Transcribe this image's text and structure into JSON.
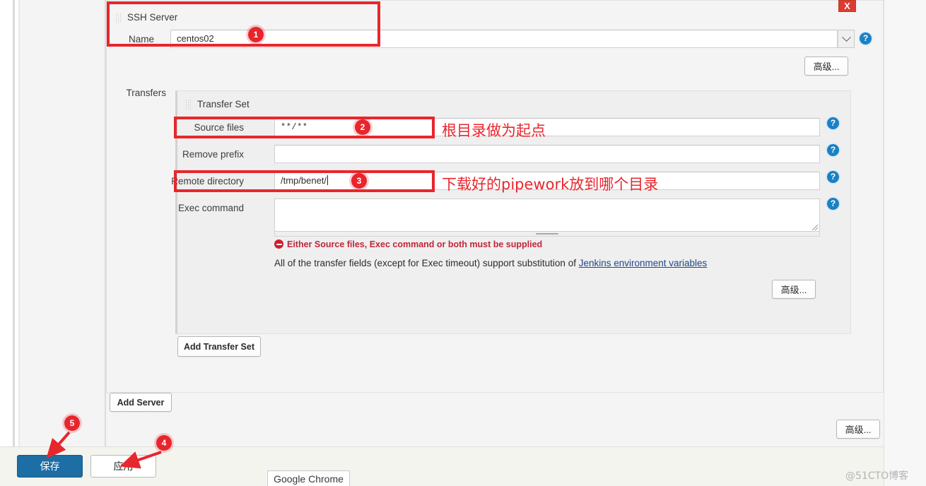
{
  "window": {
    "close_label": "X"
  },
  "server_section": {
    "title": "SSH Server",
    "name_label": "Name",
    "name_value": "centos02",
    "advanced_label": "高级...",
    "transfers_label": "Transfers",
    "add_server_label": "Add Server"
  },
  "transfer_set": {
    "title": "Transfer Set",
    "add_transfer_set_label": "Add Transfer Set",
    "advanced_label": "高级...",
    "fields": [
      {
        "label": "Source files",
        "value": "**/**",
        "placeholder": ""
      },
      {
        "label": "Remove prefix",
        "value": "",
        "placeholder": ""
      },
      {
        "label": "Remote directory",
        "value": "/tmp/benet/",
        "placeholder": ""
      },
      {
        "label": "Exec command",
        "value": "",
        "placeholder": ""
      }
    ],
    "error_message": "Either Source files, Exec command or both must be supplied",
    "hint_prefix": "All of the transfer fields (except for Exec timeout) support substitution of ",
    "hint_link": "Jenkins environment variables"
  },
  "bottom_bar": {
    "advanced_label": "高级...",
    "save_label": "保存",
    "apply_label": "应用"
  },
  "taskbar": {
    "chrome_label": "Google Chrome"
  },
  "watermark": {
    "text": "@51CTO博客"
  },
  "annotations": {
    "badges": [
      {
        "num": "1"
      },
      {
        "num": "2"
      },
      {
        "num": "3"
      },
      {
        "num": "4"
      },
      {
        "num": "5"
      }
    ],
    "notes": [
      {
        "text": "根目录做为起点"
      },
      {
        "text": "下载好的pipework放到哪个目录"
      }
    ]
  },
  "help_icon": "?",
  "colors": {
    "annotation_red": "#e8262d",
    "help_blue": "#1b80c4",
    "save_blue": "#1c6ea4",
    "error_red": "#c0263a"
  }
}
